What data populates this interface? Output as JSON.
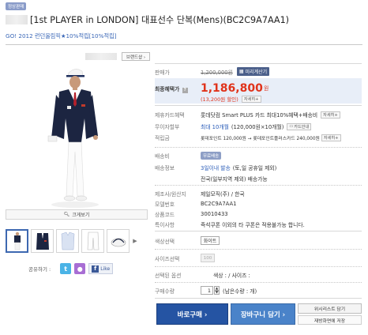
{
  "header": {
    "badge": "정상판매",
    "title": "[1st PLAYER in LONDON] 대표선수 단복(Mens)(BC2C9A7AA1)",
    "subtitle": "GO! 2012 런던올림픽★10%적립[10%적립]",
    "brandshop_button": "브랜드샵 ›"
  },
  "gallery": {
    "zoom_label": "크게보기",
    "share_label": "공유하기 :",
    "facebook_like": "Like",
    "icons": [
      "twitter-icon",
      "me2day-icon",
      "facebook-icon"
    ]
  },
  "price": {
    "label_sale": "판매가",
    "original": "1,200,000원",
    "calc_button": "미리계산기",
    "label_benefit": "최종혜택가",
    "final": "1,186,800",
    "final_unit": "원",
    "discount": "(13,200원 할인)",
    "detail_button": "자세히+"
  },
  "details": [
    {
      "label": "제휴카드혜택",
      "value": "롯데닷컴 Smart PLUS 카드 최대10%혜택+배송비",
      "button": "자세히+"
    },
    {
      "label": "무이자할부",
      "value_hl": "최대 10개월",
      "value": "(120,000원×10개월)",
      "button": "카드안내"
    },
    {
      "label": "적립금",
      "value": "롯데포인트 120,000원 → 롯데포인트플러스카드 240,000원",
      "button": "자세히+"
    }
  ],
  "shipping": {
    "label_fee": "배송비",
    "fee_badge": "무료배송",
    "label_info": "배송정보",
    "info_hl": "3일이내 발송",
    "info_rest": "(토,일 공휴일 제외)",
    "info_line2": "전국(일부지역 제외) 배송가능"
  },
  "product_info": [
    {
      "label": "제조사/원산지",
      "value": "제일모직(주) / 한국"
    },
    {
      "label": "모델번호",
      "value": "BC2C9A7AA1"
    },
    {
      "label": "상품코드",
      "value": "30010433"
    },
    {
      "label": "특이사항",
      "value": "즉석쿠폰 이외의 타 쿠폰은 적용불가능 합니다."
    }
  ],
  "options": {
    "color_label": "색상선택",
    "color_value": "화이트",
    "size_label": "사이즈선택",
    "size_value": "100",
    "selected_label": "선택된 옵션",
    "selected_value": "색상 : / 사이즈 :",
    "qty_label": "구매수량",
    "qty_value": "1",
    "qty_note": "(남은수량 : 개)"
  },
  "actions": {
    "buy": "바로구매 ›",
    "cart": "장바구니 담기 ›",
    "wishlist": "위시리스트 담기",
    "restock": "재방화면에 저장"
  },
  "colors": {
    "accent_blue": "#2554a3",
    "price_red": "#e0331b",
    "price_bg": "#e8eef8"
  }
}
